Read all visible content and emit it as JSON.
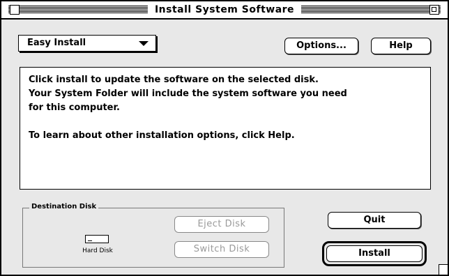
{
  "window": {
    "title": "Install System Software"
  },
  "popup": {
    "value": "Easy Install"
  },
  "buttons": {
    "options": "Options...",
    "help": "Help",
    "eject": "Eject Disk",
    "switch": "Switch Disk",
    "quit": "Quit",
    "install": "Install"
  },
  "message": {
    "line1": "Click install to update the software on the selected disk.",
    "line2": "Your System Folder will include the system software you need",
    "line3": "for this computer.",
    "line4": "To learn about other installation options, click Help."
  },
  "destination": {
    "label": "Destination Disk",
    "disk_name": "Hard Disk"
  }
}
